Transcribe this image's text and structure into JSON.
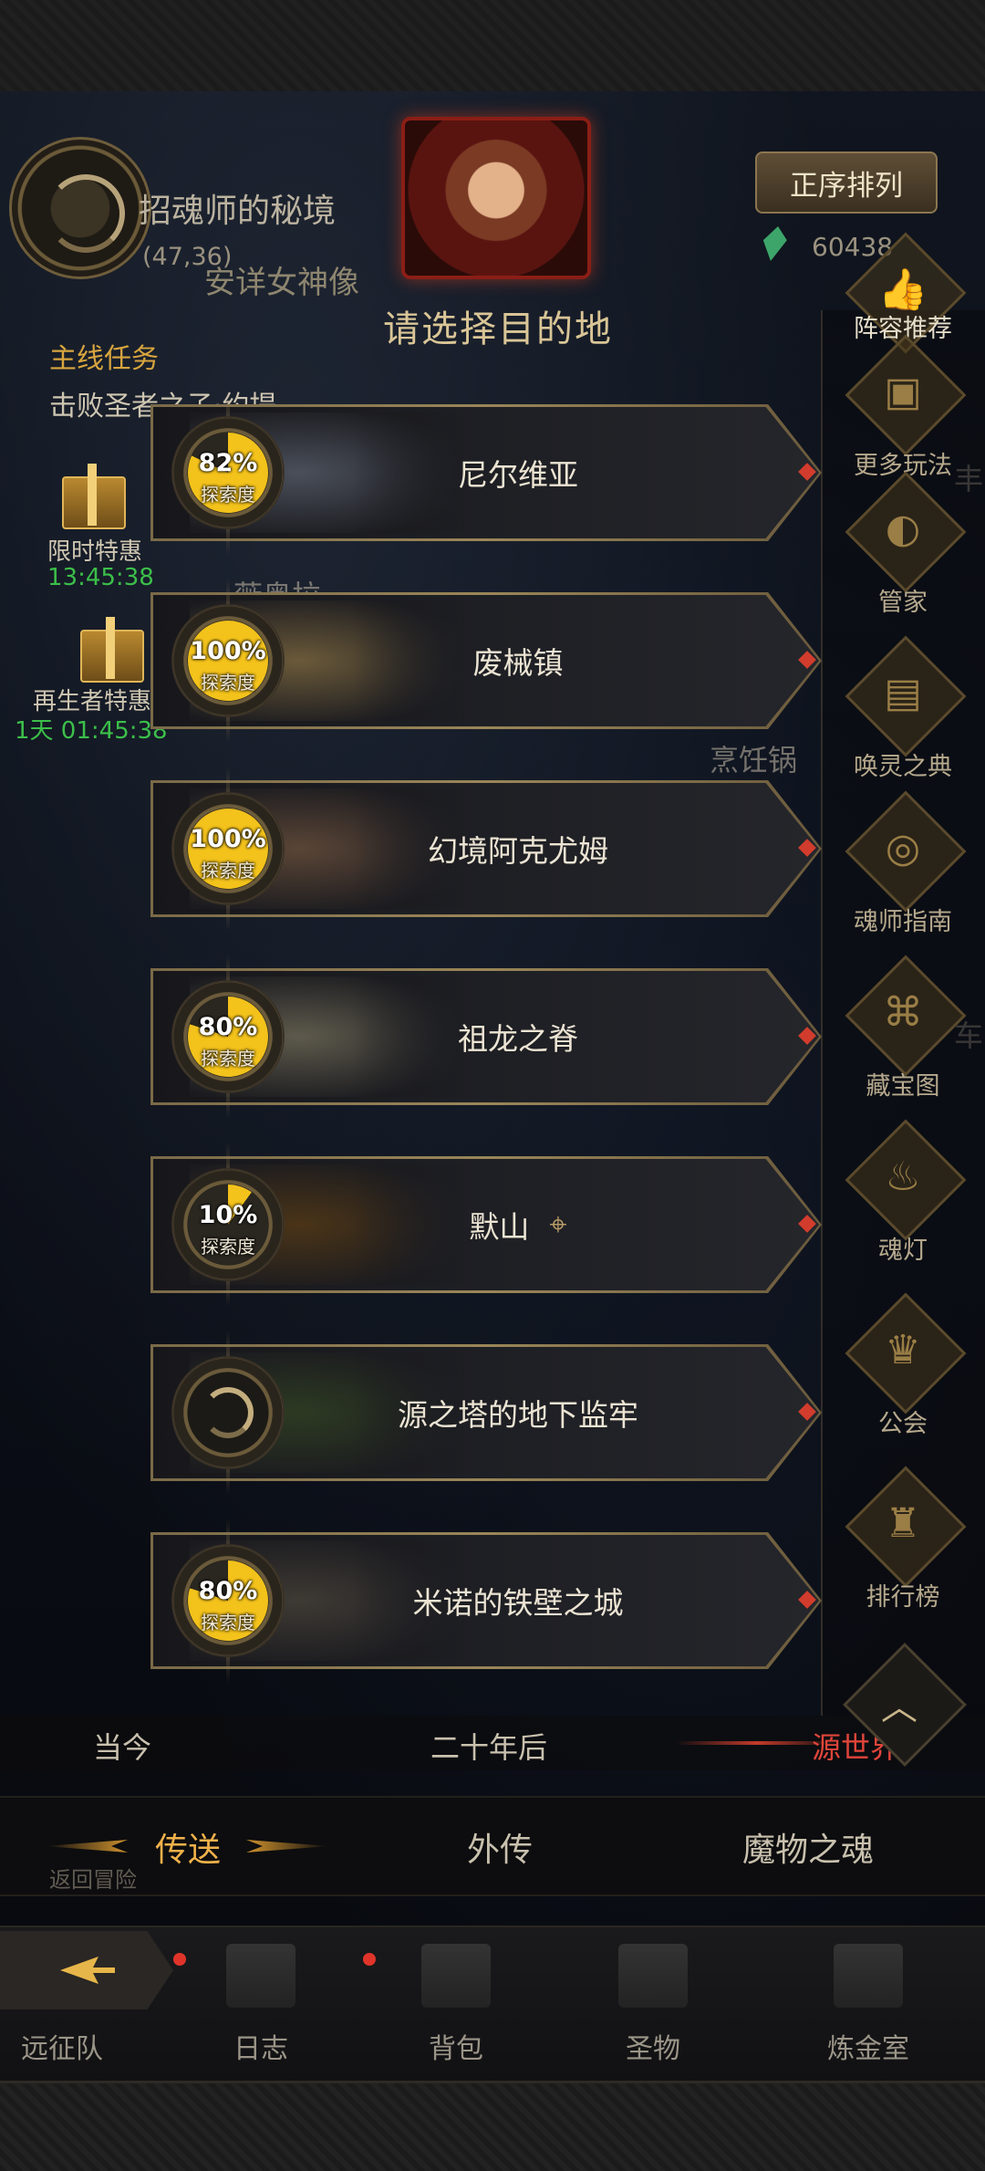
{
  "header": {
    "realm_title": "招魂师的秘境",
    "coordinates": "(47,36)",
    "sub_location": "安详女神像",
    "choose_title": "请选择目的地",
    "sort_button": "正序排列",
    "currency_value": "60438"
  },
  "left_panel": {
    "quest_label": "主线任务",
    "quest_text": "击败圣者之子·约提",
    "offers": [
      {
        "name": "限时特惠",
        "time": "13:45:38"
      },
      {
        "name": "再生者特惠",
        "time": "1天  01:45:38"
      }
    ],
    "map_labels": [
      "薇奥拉",
      "烹饪锅",
      "丰",
      "车"
    ]
  },
  "right_menu": [
    {
      "label": "阵容推荐",
      "icon": "thumbs-up-icon"
    },
    {
      "label": "更多玩法",
      "icon": "gift-box-icon"
    },
    {
      "label": "管家",
      "icon": "butler-mask-icon"
    },
    {
      "label": "唤灵之典",
      "icon": "tome-icon"
    },
    {
      "label": "魂师指南",
      "icon": "compass-book-icon"
    },
    {
      "label": "藏宝图",
      "icon": "treasure-map-icon"
    },
    {
      "label": "魂灯",
      "icon": "magic-lamp-icon"
    },
    {
      "label": "公会",
      "icon": "guild-crest-icon"
    },
    {
      "label": "排行榜",
      "icon": "trophy-icon"
    }
  ],
  "destinations": [
    {
      "name": "尼尔维亚",
      "percent": "82%",
      "fill": 0.82,
      "explore_label": "探索度",
      "current": false,
      "locked": false,
      "art": "#4a4f5a"
    },
    {
      "name": "废械镇",
      "percent": "100%",
      "fill": 1.0,
      "explore_label": "探索度",
      "current": false,
      "locked": false,
      "art": "#6b5a3a"
    },
    {
      "name": "幻境阿克尤姆",
      "percent": "100%",
      "fill": 1.0,
      "explore_label": "探索度",
      "current": false,
      "locked": false,
      "art": "#5a4536"
    },
    {
      "name": "祖龙之脊",
      "percent": "80%",
      "fill": 0.8,
      "explore_label": "探索度",
      "current": false,
      "locked": false,
      "art": "#5e5a4c"
    },
    {
      "name": "默山",
      "percent": "10%",
      "fill": 0.1,
      "explore_label": "探索度",
      "current": true,
      "locked": false,
      "art": "#4a3418"
    },
    {
      "name": "源之塔的地下监牢",
      "percent": "",
      "fill": 0,
      "explore_label": "",
      "current": false,
      "locked": true,
      "art": "#2d3a22"
    },
    {
      "name": "米诺的铁壁之城",
      "percent": "80%",
      "fill": 0.8,
      "explore_label": "探索度",
      "current": false,
      "locked": false,
      "art": "#3e3a34"
    }
  ],
  "era_tabs": {
    "left": "当今",
    "middle": "二十年后",
    "active": "源世界"
  },
  "main_tabs": {
    "teleport": "传送",
    "side_story": "外传",
    "monster_soul": "魔物之魂"
  },
  "behind_text": "返回冒险",
  "bottom_nav": [
    {
      "label": "远征队",
      "icon": "expedition-icon"
    },
    {
      "label": "日志",
      "icon": "journal-scroll-icon"
    },
    {
      "label": "背包",
      "icon": "backpack-icon"
    },
    {
      "label": "圣物",
      "icon": "relic-icon"
    },
    {
      "label": "炼金室",
      "icon": "alchemy-icon"
    }
  ],
  "colors": {
    "accent_gold": "#f0b24a",
    "explore_yellow": "#f3c21b",
    "active_red": "#e0453a",
    "timer_green": "#3cbf4a"
  }
}
